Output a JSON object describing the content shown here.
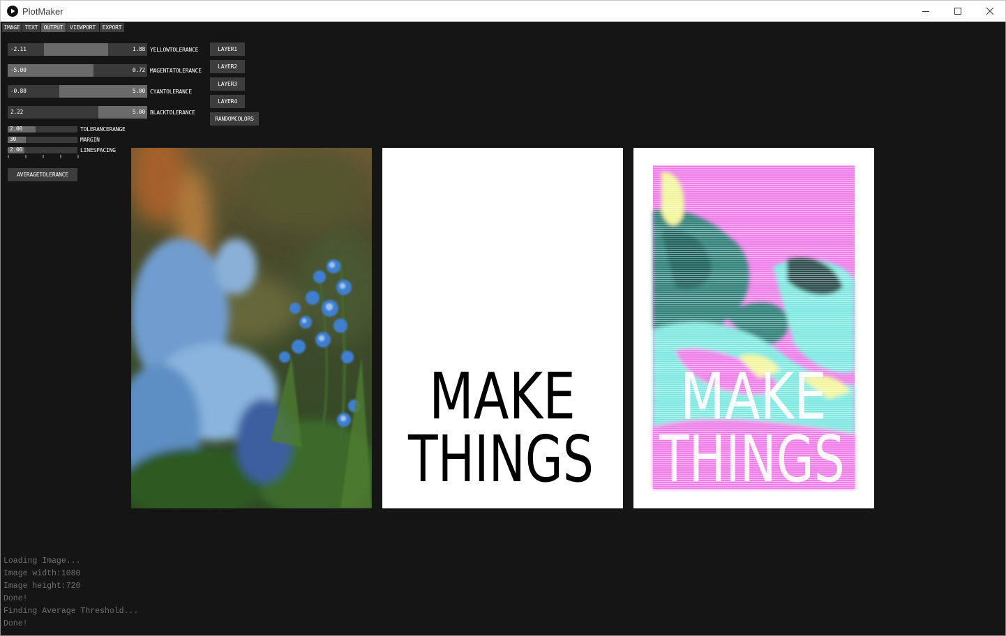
{
  "window": {
    "title": "PlotMaker",
    "icons": [
      "play-icon",
      "minimize-icon",
      "maximize-icon",
      "close-icon"
    ]
  },
  "tabs": [
    {
      "label": "IMAGE"
    },
    {
      "label": "TEXT"
    },
    {
      "label": "OUTPUT",
      "active": true
    },
    {
      "label": "VIEWPORT"
    },
    {
      "label": "EXPORT"
    }
  ],
  "sliders": {
    "yellow": {
      "low": "-2.11",
      "high": "1.88",
      "label": "YELLOWTOLERANCE"
    },
    "magenta": {
      "low": "-5.00",
      "high": "0.72",
      "label": "MAGENTATOLERANCE"
    },
    "cyan": {
      "low": "-0.88",
      "high": "5.00",
      "label": "CYANTOLERANCE"
    },
    "black": {
      "low": "2.22",
      "high": "5.00",
      "label": "BLACKTOLERANCE"
    },
    "tolerance_range": {
      "value": "2.00",
      "label": "TOLERANCERANGE"
    },
    "margin": {
      "value": "30",
      "label": "MARGIN"
    },
    "line_spacing": {
      "value": "2.00",
      "label": "LINESPACING"
    }
  },
  "buttons": {
    "layer1": "LAYER1",
    "layer2": "LAYER2",
    "layer3": "LAYER3",
    "layer4": "LAYER4",
    "random_colors": "RANDOMCOLORS",
    "average_tolerance": "AVERAGETOLERANCE"
  },
  "preview": {
    "text_line1": "MAKE",
    "text_line2": "THINGS"
  },
  "log": [
    "Loading Image...",
    "Image width:1080",
    "Image height:720",
    "Done!",
    "Finding Average Threshold...",
    "Done!"
  ],
  "colors": {
    "background": "#151515",
    "control": "#3d3d3d",
    "control_fill": "#6a6a6a",
    "log_text": "#6f6f6f",
    "magenta": "#ee7ee8",
    "cyan": "#7ee8e0",
    "teal": "#2f7f78",
    "yellow": "#f2f59a"
  }
}
